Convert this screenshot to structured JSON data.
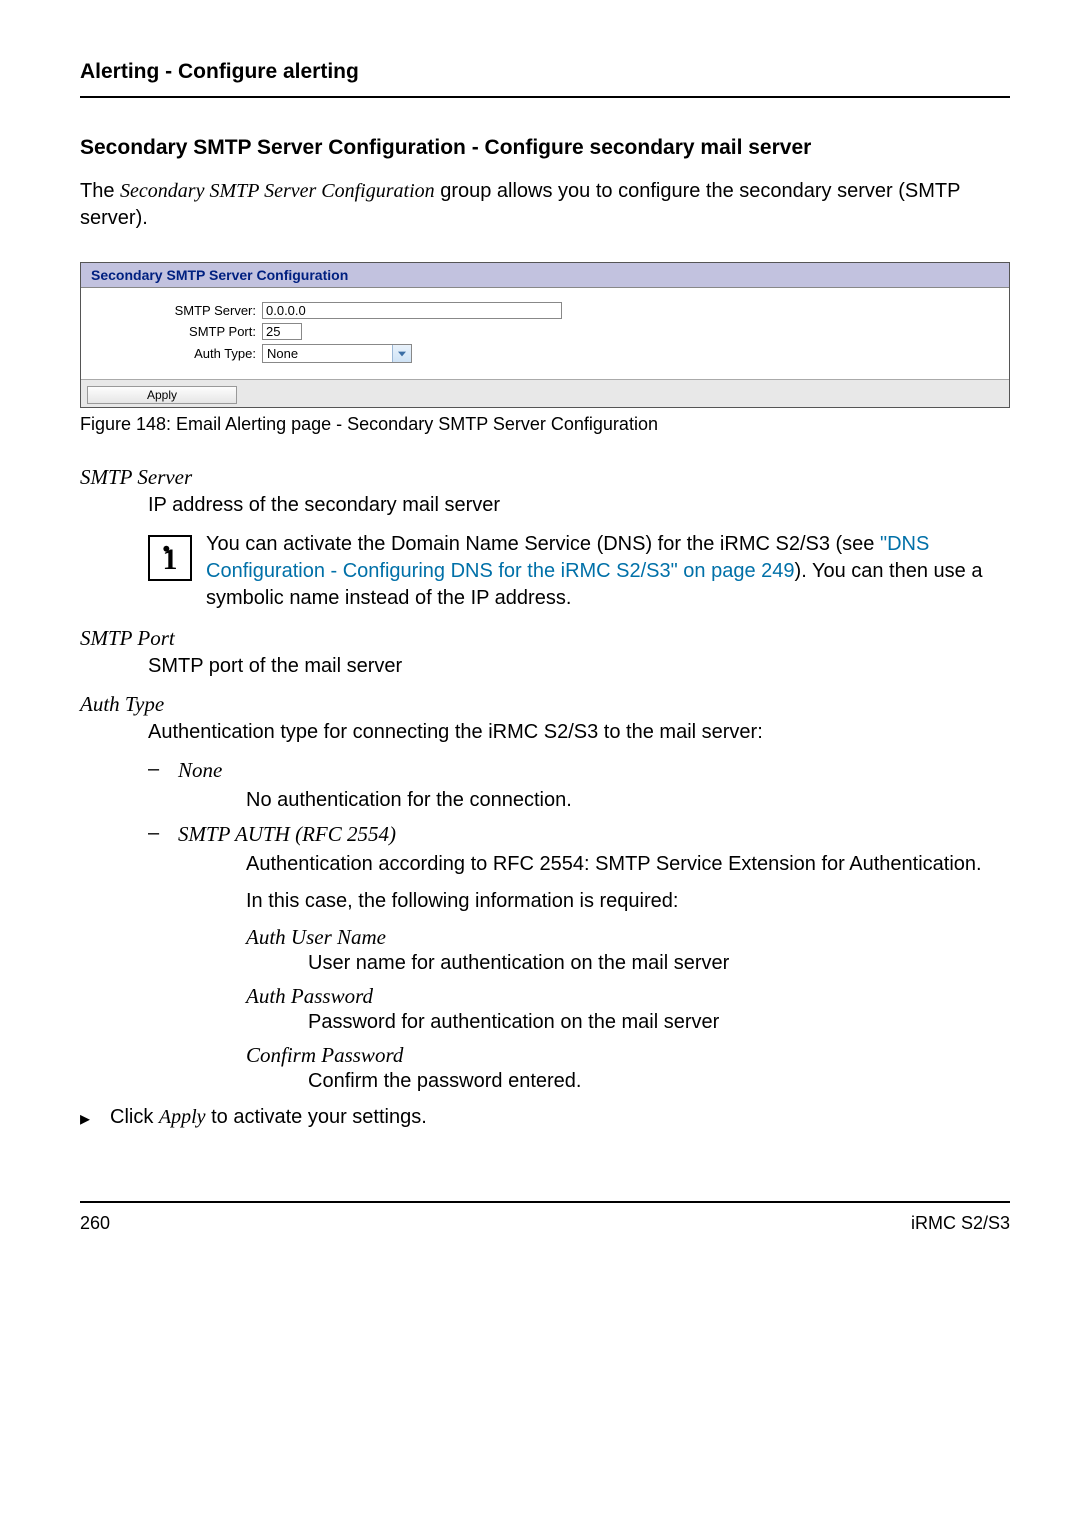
{
  "header": {
    "title": "Alerting - Configure alerting"
  },
  "section": {
    "heading": "Secondary SMTP Server Configuration - Configure secondary mail server",
    "intro_prefix": "The ",
    "intro_italic": "Secondary SMTP Server Configuration",
    "intro_suffix": " group allows you to configure the secondary server (SMTP server)."
  },
  "panel": {
    "title": "Secondary SMTP Server Configuration",
    "rows": {
      "server_label": "SMTP Server:",
      "server_value": "0.0.0.0",
      "port_label": "SMTP Port:",
      "port_value": "25",
      "auth_label": "Auth Type:",
      "auth_value": "None"
    },
    "apply_label": "Apply"
  },
  "caption": "Figure 148: Email Alerting page - Secondary SMTP Server Configuration",
  "defs": {
    "smtp_server": {
      "term": "SMTP Server",
      "desc": "IP address of the secondary mail server",
      "info_prefix": " You can activate the Domain Name Service (DNS) for the iRMC S2/S3 (see ",
      "info_link": "\"DNS Configuration - Configuring DNS for the iRMC S2/S3\" on page 249",
      "info_suffix": "). You can then use a symbolic name instead of the IP address."
    },
    "smtp_port": {
      "term": "SMTP Port",
      "desc": "SMTP port of the mail server"
    },
    "auth_type": {
      "term": "Auth Type",
      "desc": "Authentication type for connecting the iRMC S2/S3 to the mail server:",
      "none": {
        "term": "None",
        "desc": "No authentication for the connection."
      },
      "smtp_auth": {
        "term": "SMTP AUTH (RFC 2554)",
        "desc": "Authentication according to RFC 2554: SMTP Service Extension for Authentication.",
        "extra": "In this case, the following information is required:",
        "user": {
          "term": "Auth User Name",
          "desc": "User name for authentication on the mail server"
        },
        "pass": {
          "term": "Auth Password",
          "desc": "Password for authentication on the mail server"
        },
        "confirm": {
          "term": "Confirm Password",
          "desc": "Confirm the password entered."
        }
      }
    }
  },
  "action": {
    "prefix": "Click ",
    "italic": "Apply",
    "suffix": " to activate your settings."
  },
  "footer": {
    "page": "260",
    "product": "iRMC S2/S3"
  }
}
